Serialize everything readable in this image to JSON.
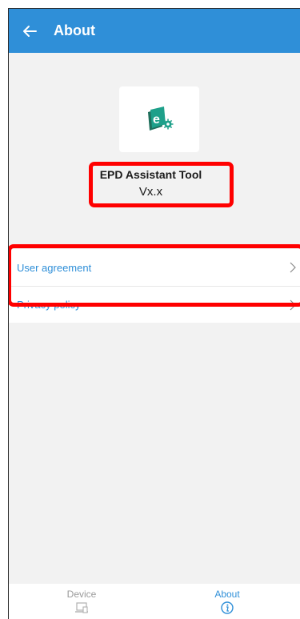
{
  "header": {
    "title": "About",
    "back_icon": "arrow-left-icon"
  },
  "app_info": {
    "logo_icon": "epd-app-logo-icon",
    "logo_letter": "e",
    "name": "EPD Assistant Tool",
    "version": "Vx.x"
  },
  "menu": {
    "items": [
      {
        "label": "User agreement"
      },
      {
        "label": "Privacy policy"
      }
    ]
  },
  "bottom_nav": {
    "tabs": [
      {
        "label": "Device",
        "icon": "laptop-icon",
        "active": false
      },
      {
        "label": "About",
        "icon": "info-icon",
        "active": true
      }
    ]
  },
  "colors": {
    "accent": "#2f8fd8",
    "background": "#f2f2f2",
    "highlight": "#ff0000",
    "logo_green": "#1ea08a"
  }
}
